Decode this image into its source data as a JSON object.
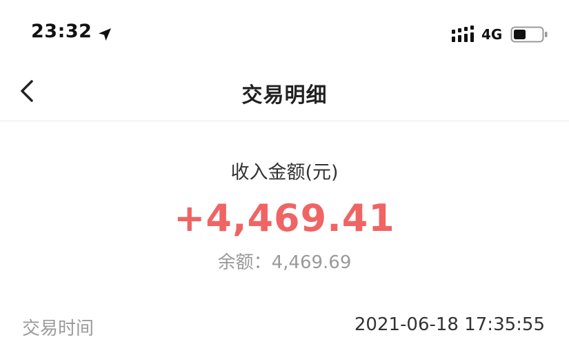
{
  "status_bar": {
    "time": "23:32",
    "network": "4G",
    "icons": [
      "location-arrow-icon",
      "cellular-signal-icon",
      "battery-icon"
    ]
  },
  "nav": {
    "back_icon": "chevron-left-icon",
    "title": "交易明细"
  },
  "amount": {
    "label": "收入金额(元)",
    "value": "+4,469.41",
    "value_color": "#f06464"
  },
  "balance": {
    "label": "余额：",
    "value": "4,469.69"
  },
  "details": [
    {
      "key": "交易时间",
      "value": "2021-06-18 17:35:55"
    }
  ]
}
